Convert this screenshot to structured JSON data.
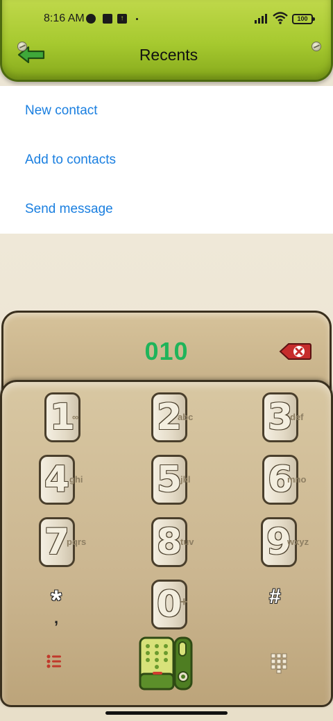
{
  "status_bar": {
    "time": "8:16 AM",
    "battery": "100"
  },
  "header": {
    "title": "Recents",
    "back_icon": "back-arrow-icon"
  },
  "menu": {
    "items": [
      {
        "label": "New contact"
      },
      {
        "label": "Add to contacts"
      },
      {
        "label": "Send message"
      }
    ]
  },
  "dialer": {
    "number": "010",
    "delete_icon": "backspace-icon",
    "accent_color": "#1fb45a",
    "keys": [
      {
        "digit": "1",
        "sub": "∞"
      },
      {
        "digit": "2",
        "sub": "abc"
      },
      {
        "digit": "3",
        "sub": "def"
      },
      {
        "digit": "4",
        "sub": "ghi"
      },
      {
        "digit": "5",
        "sub": "jkl"
      },
      {
        "digit": "6",
        "sub": "mno"
      },
      {
        "digit": "7",
        "sub": "pqrs"
      },
      {
        "digit": "8",
        "sub": "tuv"
      },
      {
        "digit": "9",
        "sub": "wxyz"
      },
      {
        "digit": "*",
        "sub": ","
      },
      {
        "digit": "0",
        "sub": "+"
      },
      {
        "digit": "#",
        "sub": ""
      }
    ],
    "bottom_bar": {
      "menu_icon": "menu-list-icon",
      "call_icon": "call-phone-icon",
      "keypad_icon": "keypad-grid-icon"
    }
  },
  "colors": {
    "header_green": "#a6c92f",
    "link_blue": "#1a7fe0",
    "panel_tan": "#cbb690"
  }
}
